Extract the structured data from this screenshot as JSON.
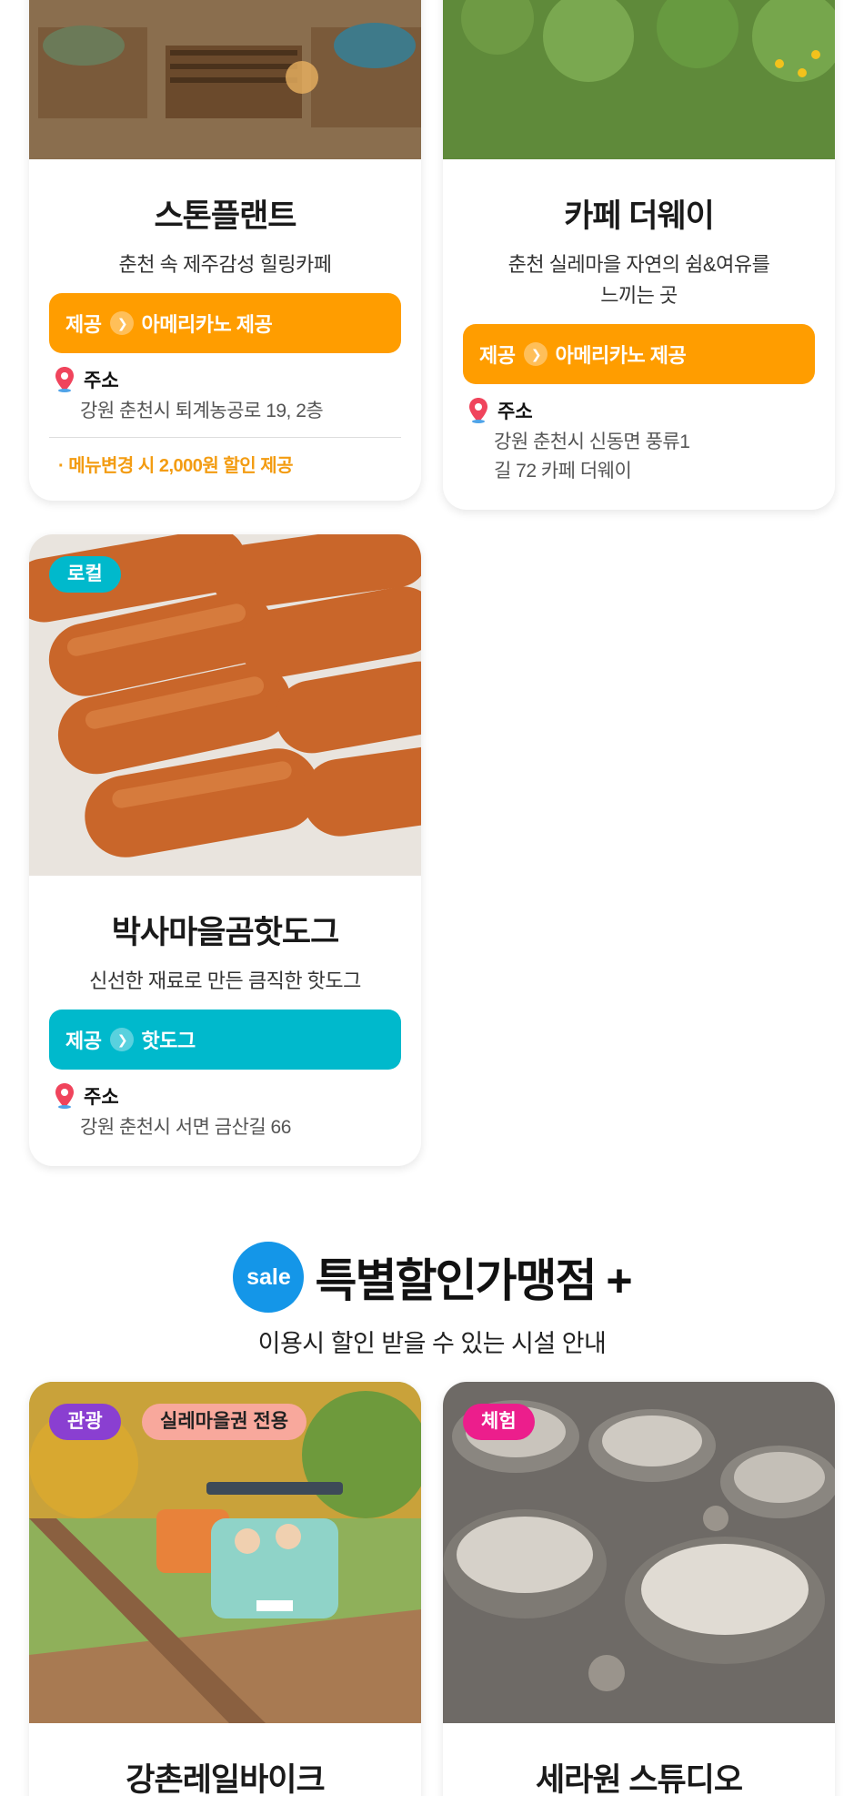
{
  "cards": [
    {
      "title": "스톤플랜트",
      "desc": "춘천 속 제주감성 힐링카페",
      "offer_label": "제공",
      "offer_value": "아메리카노 제공",
      "addr_label": "주소",
      "address": "강원 춘천시 퇴계농공로 19, 2층",
      "note": "· 메뉴변경 시 2,000원 할인 제공"
    },
    {
      "title": "카페 더웨이",
      "desc": "춘천 실레마을 자연의 쉼&여유를 느끼는 곳",
      "offer_label": "제공",
      "offer_value": "아메리카노 제공",
      "addr_label": "주소",
      "address": "강원 춘천시 신동면 풍류1길 72 카페 더웨이"
    },
    {
      "badge": "로컬",
      "title": "박사마을곰핫도그",
      "desc": "신선한 재료로 만든 큼직한 핫도그",
      "offer_label": "제공",
      "offer_value": "핫도그",
      "addr_label": "주소",
      "address": "강원 춘천시 서면 금산길 66"
    }
  ],
  "section": {
    "sale_icon": "sale",
    "title": "특별할인가맹점 +",
    "subtitle": "이용시 할인 받을 수 있는 시설 안내"
  },
  "bottom_cards": [
    {
      "badge": "관광",
      "badge2": "실레마을권 전용",
      "title": "강촌레일바이크"
    },
    {
      "badge": "체험",
      "title": "세라원 스튜디오"
    }
  ],
  "colors": {
    "orange": "#ff9d00",
    "teal": "#00b9cc",
    "purple": "#8a3fd1",
    "pink_badge": "#f8a89c",
    "magenta": "#ec1e8c",
    "sale_blue": "#1496e8"
  }
}
